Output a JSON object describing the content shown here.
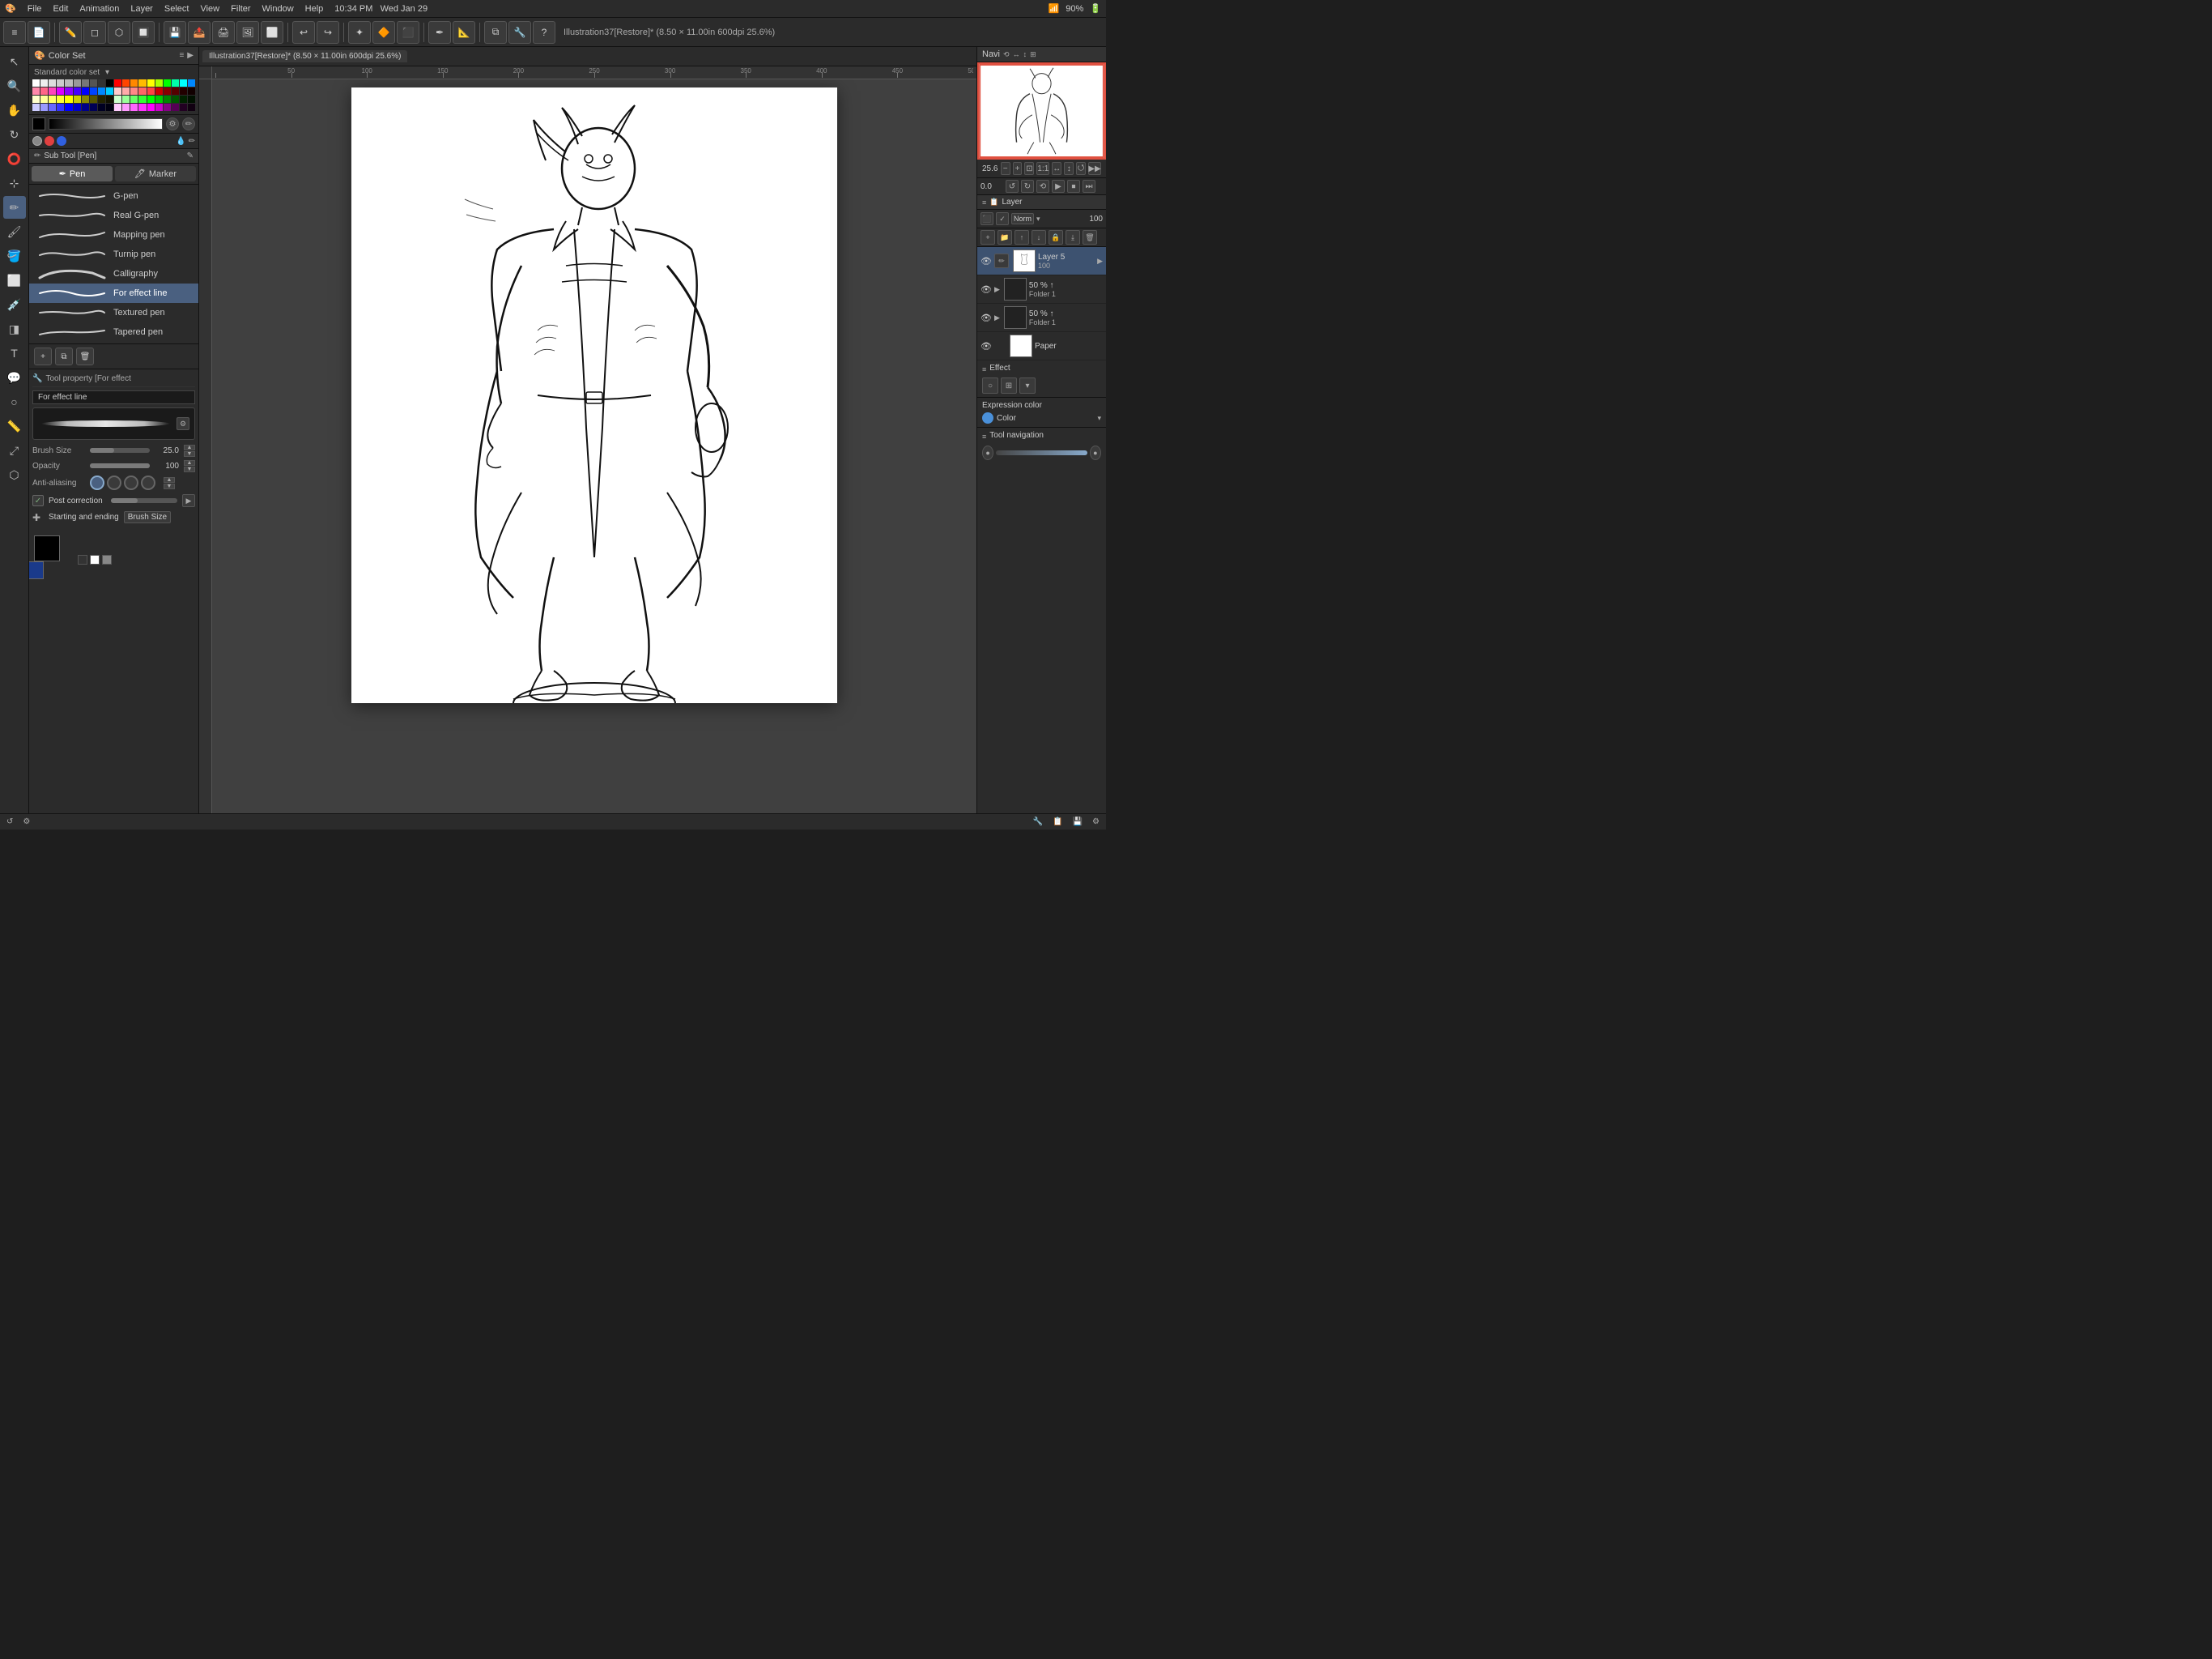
{
  "app": {
    "time": "10:34 PM",
    "day": "Wed Jan 29",
    "battery": "90%",
    "wifi_icon": "📶"
  },
  "menu": {
    "items": [
      "File",
      "Edit",
      "Animation",
      "Layer",
      "Select",
      "View",
      "Filter",
      "Window",
      "Help"
    ]
  },
  "document": {
    "title": "Illustration37[Restore]* (8.50 × 11.00in 600dpi 25.6%)"
  },
  "color_panel": {
    "header_label": "Color Set",
    "standard_color_label": "Standard color set",
    "swatches": [
      "#ffffff",
      "#eeeeee",
      "#dddddd",
      "#cccccc",
      "#bbbbbb",
      "#999999",
      "#777777",
      "#555555",
      "#333333",
      "#000000",
      "#ff0000",
      "#ff4400",
      "#ff8800",
      "#ffbb00",
      "#ffff00",
      "#aaff00",
      "#00ff00",
      "#00ffaa",
      "#00ffff",
      "#0088ff",
      "#ff88aa",
      "#ff6688",
      "#ff44bb",
      "#dd00ff",
      "#8800ff",
      "#4400ff",
      "#0000ff",
      "#0044ff",
      "#0088ff",
      "#00ccff",
      "#ffcccc",
      "#ffaaaa",
      "#ff8888",
      "#ff6666",
      "#ff4444",
      "#cc0000",
      "#880000",
      "#550000",
      "#220000",
      "#110000",
      "#ffffcc",
      "#ffff99",
      "#ffff66",
      "#ffff33",
      "#ffff00",
      "#cccc00",
      "#888800",
      "#555500",
      "#222200",
      "#111100",
      "#ccffcc",
      "#99ff99",
      "#66ff66",
      "#33ff33",
      "#00ff00",
      "#00cc00",
      "#008800",
      "#005500",
      "#002200",
      "#001100",
      "#ccccff",
      "#9999ff",
      "#6666ff",
      "#3333ff",
      "#0000ff",
      "#0000cc",
      "#000088",
      "#000055",
      "#000022",
      "#000011",
      "#ffccff",
      "#ff99ff",
      "#ff66ff",
      "#ff33ff",
      "#ff00ff",
      "#cc00cc",
      "#880088",
      "#550055",
      "#220022",
      "#110011"
    ]
  },
  "brush_panel": {
    "sub_tool_label": "Sub Tool [Pen]",
    "pen_tab": "Pen",
    "marker_tab": "Marker",
    "brushes": [
      {
        "name": "G-pen",
        "active": false
      },
      {
        "name": "Real G-pen",
        "active": false
      },
      {
        "name": "Mapping pen",
        "active": false
      },
      {
        "name": "Turnip pen",
        "active": false
      },
      {
        "name": "Calligraphy",
        "active": false
      },
      {
        "name": "For effect line",
        "active": true
      },
      {
        "name": "Textured pen",
        "active": false
      },
      {
        "name": "Tapered pen",
        "active": false
      }
    ]
  },
  "tool_property": {
    "label": "Tool property [For effect",
    "brush_name": "For effect line",
    "brush_size_label": "Brush Size",
    "brush_size_value": "25.0",
    "opacity_label": "Opacity",
    "opacity_value": "100",
    "antialias_label": "Anti-aliasing",
    "post_correction_label": "Post correction",
    "post_correction_checked": true,
    "starting_ending_label": "Starting and ending",
    "starting_ending_value": "Brush Size"
  },
  "navigator": {
    "title": "Navi",
    "zoom_value": "25.6",
    "rotation_value": "0.0"
  },
  "layers": {
    "title": "Layer",
    "blend_mode": "Norm",
    "opacity_value": "100",
    "items": [
      {
        "name": "Layer 5",
        "opacity": "100",
        "active": true,
        "has_thumb": true
      },
      {
        "name": "Folder 1",
        "opacity": "50 %",
        "active": false,
        "has_thumb": false
      },
      {
        "name": "Folder 1",
        "opacity": "50 %",
        "active": false,
        "has_thumb": false
      },
      {
        "name": "Paper",
        "opacity": "",
        "active": false,
        "has_thumb": true,
        "is_white": true
      }
    ]
  },
  "effects": {
    "title": "Effect",
    "expression_color_title": "Expression color",
    "expression_color_value": "Color",
    "tool_navigation_title": "Tool navigation"
  },
  "bottom_status": {
    "items": [
      "",
      ""
    ]
  }
}
